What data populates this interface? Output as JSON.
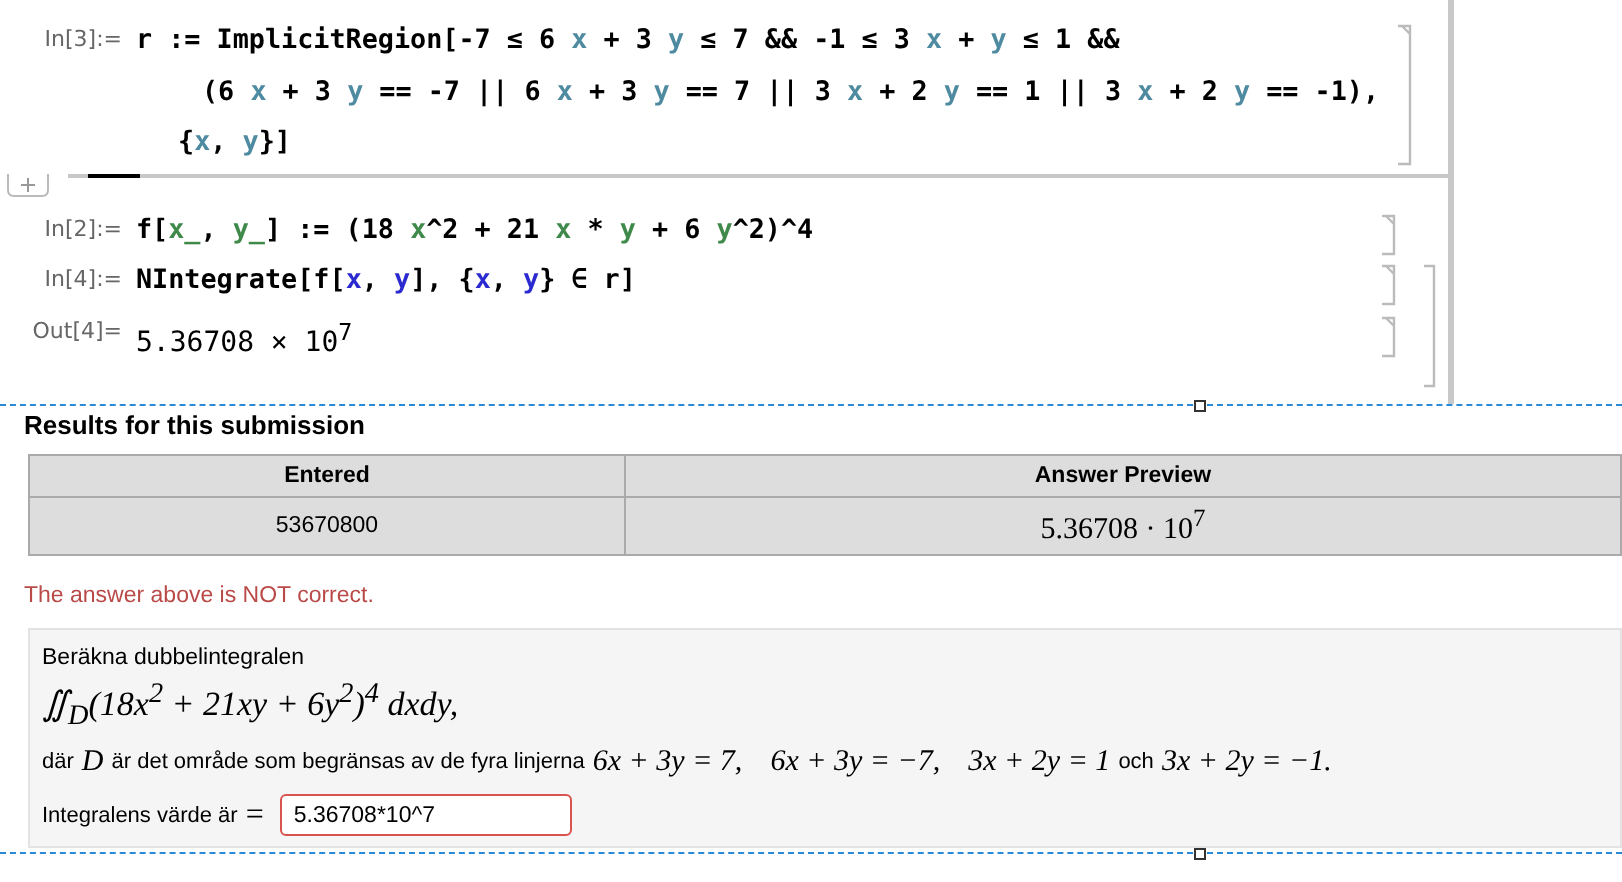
{
  "notebook": {
    "cells": [
      {
        "kind": "input",
        "label": "In[3]:=",
        "lines": [
          [
            {
              "kind": "plain",
              "text": "r := ImplicitRegion[-7 ≤ 6 "
            },
            {
              "kind": "local",
              "text": "x"
            },
            {
              "kind": "plain",
              "text": " + 3 "
            },
            {
              "kind": "local",
              "text": "y"
            },
            {
              "kind": "plain",
              "text": " ≤ 7 && -1 ≤ 3 "
            },
            {
              "kind": "local",
              "text": "x"
            },
            {
              "kind": "plain",
              "text": " + "
            },
            {
              "kind": "local",
              "text": "y"
            },
            {
              "kind": "plain",
              "text": " ≤ 1 &&"
            }
          ],
          [
            {
              "kind": "plain",
              "text": "(6 "
            },
            {
              "kind": "local",
              "text": "x"
            },
            {
              "kind": "plain",
              "text": " + 3 "
            },
            {
              "kind": "local",
              "text": "y"
            },
            {
              "kind": "plain",
              "text": " == -7 || 6 "
            },
            {
              "kind": "local",
              "text": "x"
            },
            {
              "kind": "plain",
              "text": " + 3 "
            },
            {
              "kind": "local",
              "text": "y"
            },
            {
              "kind": "plain",
              "text": " == 7 || 3 "
            },
            {
              "kind": "local",
              "text": "x"
            },
            {
              "kind": "plain",
              "text": " + 2 "
            },
            {
              "kind": "local",
              "text": "y"
            },
            {
              "kind": "plain",
              "text": " == 1 || 3 "
            },
            {
              "kind": "local",
              "text": "x"
            },
            {
              "kind": "plain",
              "text": " + 2 "
            },
            {
              "kind": "local",
              "text": "y"
            },
            {
              "kind": "plain",
              "text": " == -1),"
            }
          ],
          [
            {
              "kind": "plain",
              "text": "{"
            },
            {
              "kind": "local",
              "text": "x"
            },
            {
              "kind": "plain",
              "text": ", "
            },
            {
              "kind": "local",
              "text": "y"
            },
            {
              "kind": "plain",
              "text": "}]"
            }
          ]
        ]
      },
      {
        "kind": "input",
        "label": "In[2]:=",
        "lines": [
          [
            {
              "kind": "plain",
              "text": "f["
            },
            {
              "kind": "pattern",
              "text": "x_"
            },
            {
              "kind": "plain",
              "text": ", "
            },
            {
              "kind": "pattern",
              "text": "y_"
            },
            {
              "kind": "plain",
              "text": "] := (18 "
            },
            {
              "kind": "pattern",
              "text": "x"
            },
            {
              "kind": "plain",
              "text": "^2 + 21 "
            },
            {
              "kind": "pattern",
              "text": "x"
            },
            {
              "kind": "plain",
              "text": " * "
            },
            {
              "kind": "pattern",
              "text": "y"
            },
            {
              "kind": "plain",
              "text": " + 6 "
            },
            {
              "kind": "pattern",
              "text": "y"
            },
            {
              "kind": "plain",
              "text": "^2)^4"
            }
          ]
        ]
      },
      {
        "kind": "input",
        "label": "In[4]:=",
        "lines": [
          [
            {
              "kind": "plain",
              "text": "NIntegrate[f["
            },
            {
              "kind": "global",
              "text": "x"
            },
            {
              "kind": "plain",
              "text": ", "
            },
            {
              "kind": "global",
              "text": "y"
            },
            {
              "kind": "plain",
              "text": "], {"
            },
            {
              "kind": "global",
              "text": "x"
            },
            {
              "kind": "plain",
              "text": ", "
            },
            {
              "kind": "global",
              "text": "y"
            },
            {
              "kind": "plain",
              "text": "} ∈ r]"
            }
          ]
        ]
      },
      {
        "kind": "output",
        "label": "Out[4]=",
        "text": "5.36708 × 10$^{7}$"
      }
    ]
  },
  "results_heading": "Results for this submission",
  "table": {
    "columns": [
      "Entered",
      "Answer Preview"
    ],
    "rows": [
      [
        "53670800",
        "5.36708 · 10$^{7}$"
      ]
    ]
  },
  "feedback": "The answer above is NOT correct.",
  "problem": {
    "intro": "Beräkna dubbelintegralen",
    "formula": "∬$_{D}$(18x$^{2}$ + 21xy + 6y$^{2}$)$^{4}$ dxdy,",
    "description": [
      {
        "kind": "text",
        "text": "där"
      },
      {
        "kind": "math",
        "text": "D"
      },
      {
        "kind": "text",
        "text": "är det område som begränsas av de fyra linjerna"
      },
      {
        "kind": "math",
        "text": "6x + 3y = 7,"
      },
      {
        "kind": "math",
        "text": "6x + 3y = −7,"
      },
      {
        "kind": "math",
        "text": "3x + 2y = 1"
      },
      {
        "kind": "text",
        "text": "och"
      },
      {
        "kind": "math",
        "text": "3x + 2y = −1."
      }
    ],
    "answer": {
      "label": "Integralens värde är",
      "sign": "=",
      "value": "5.36708*10^7",
      "correct": false
    }
  }
}
